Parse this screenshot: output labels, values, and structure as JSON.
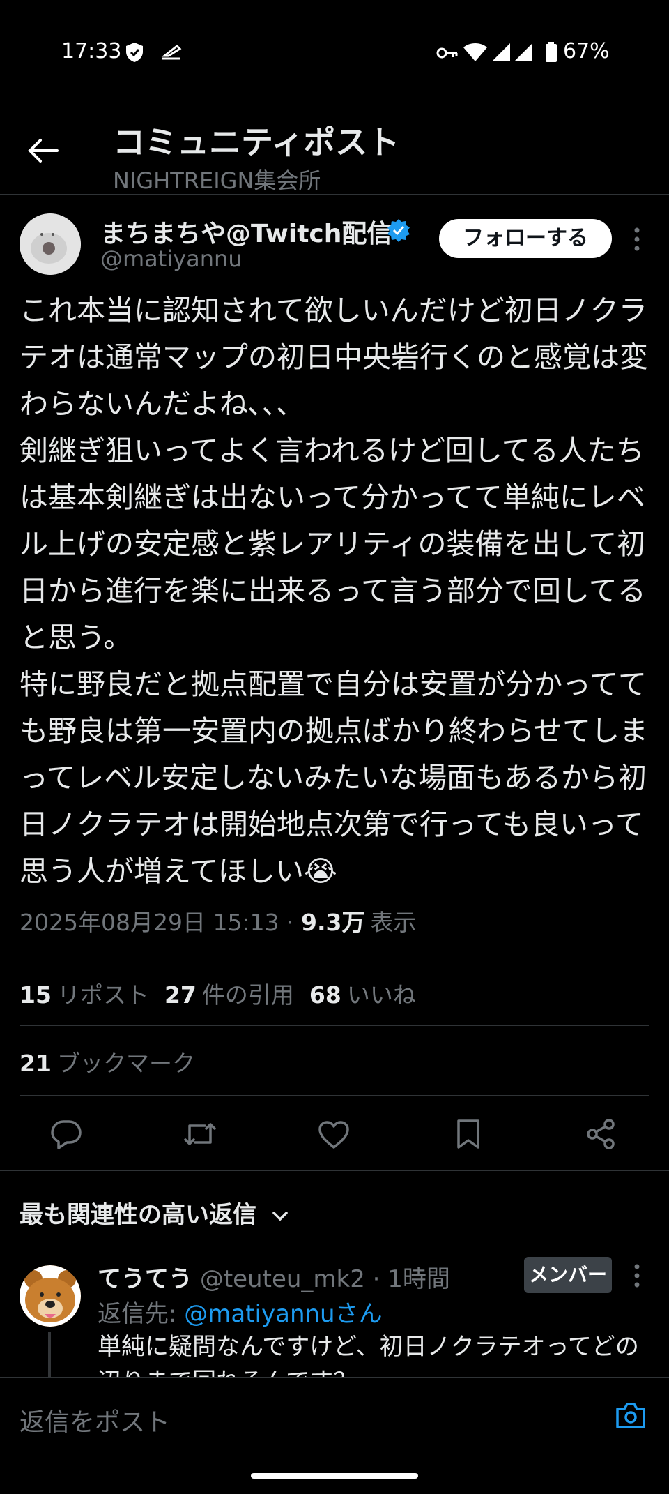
{
  "status_bar": {
    "time": "17:33",
    "battery": "67%"
  },
  "header": {
    "title": "コミュニティポスト",
    "community": "NIGHTREIGN集会所"
  },
  "post": {
    "display_name": "まちまちや@Twitch配信",
    "handle": "@matiyannu",
    "follow_label": "フォローする",
    "text": "これ本当に認知されて欲しいんだけど初日ノクラテオは通常マップの初日中央砦行くのと感覚は変わらないんだよね､､､\n剣継ぎ狙いってよく言われるけど回してる人たちは基本剣継ぎは出ないって分かってて単純にレベル上げの安定感と紫レアリティの装備を出して初日から進行を楽に出来るって言う部分で回してると思う。\n特に野良だと拠点配置で自分は安置が分かってても野良は第一安置内の拠点ばかり終わらせてしまってレベル安定しないみたいな場面もあるから初日ノクラテオは開始地点次第で行っても良いって思う人が増えてほしい😭",
    "timestamp": "2025年08月29日 15:13 · ",
    "views": "9.3万",
    "views_label": "表示"
  },
  "stats": {
    "reposts": "15",
    "reposts_label": "リポスト",
    "quotes": "27",
    "quotes_label": "件の引用",
    "likes": "68",
    "likes_label": "いいね",
    "bookmarks": "21",
    "bookmarks_label": "ブックマーク"
  },
  "replies_section": {
    "sort_label": "最も関連性の高い返信"
  },
  "reply": {
    "display_name": "てうてう",
    "handle": "@teuteu_mk2",
    "time": " · 1時間",
    "badge": "メンバー",
    "reply_to_prefix": "返信先: ",
    "reply_to_user": "@matiyannuさん",
    "text": "単純に疑問なんですけど、初日ノクラテオってどの辺りまで回れるんです？"
  },
  "composer": {
    "placeholder": "返信をポスト"
  },
  "colors": {
    "accent": "#1d9bf0",
    "verified": "#1d9bf0",
    "background": "#000000"
  }
}
